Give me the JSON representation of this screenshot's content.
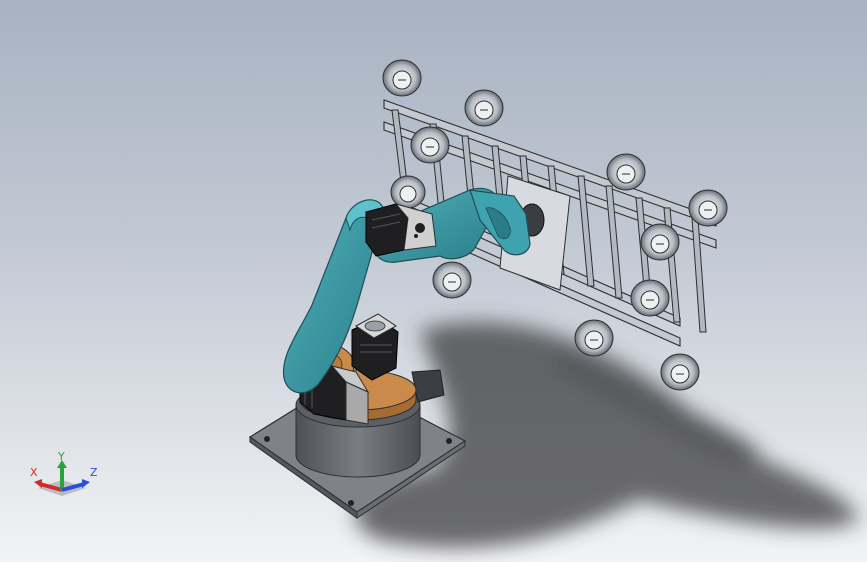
{
  "viewport": {
    "background_top": "#a7b2c2",
    "background_bottom": "#f2f3f5"
  },
  "model": {
    "colors": {
      "arm": "#3a9aa6",
      "arm_dark": "#2a7d88",
      "turntable": "#c98a4a",
      "base": "#6a6e73",
      "base_plate": "#8a8e92",
      "motor": "#2a2a2a",
      "motor_cap": "#c9c9c9",
      "frame": "#b8bec6",
      "frame_edge": "#2b2f33",
      "shadow": "#3c3c40"
    }
  },
  "triad": {
    "x_label": "X",
    "y_label": "Y",
    "z_label": "Z",
    "x_color": "#d22b2b",
    "y_color": "#2aa33a",
    "z_color": "#2a4fd6"
  }
}
